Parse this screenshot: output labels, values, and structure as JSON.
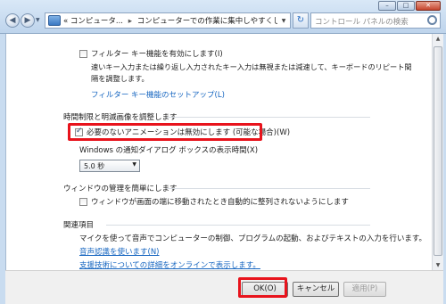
{
  "window": {
    "minimize": "–",
    "maximize": "□",
    "close": "✕"
  },
  "nav": {
    "back": "◀",
    "forward": "▶",
    "dropdown": "▼"
  },
  "address": {
    "chevrons": "«",
    "crumb1": "コンピュータ...",
    "crumb2": "コンピューターでの作業に集中しやすくします",
    "arrow": "▼"
  },
  "refresh_glyph": "↻",
  "search": {
    "placeholder": "コントロール パネルの検索"
  },
  "filter_keys": {
    "checkbox_label": "フィルター キー機能を有効にします(I)",
    "checked": false,
    "description_line1": "速いキー入力または繰り返し入力されたキー入力は無視または減速して、キーボードのリピート間",
    "description_line2": "隔を調整します。",
    "setup_link": "フィルター キー機能のセットアップ(L)"
  },
  "time_limits": {
    "heading": "時間制限と明滅画像を調整します",
    "animation_checkbox": "必要のないアニメーションは無効にします (可能な場合)(W)",
    "animation_checked": true,
    "notify_label": "Windows の通知ダイアログ ボックスの表示時間(X)",
    "notify_value": "5.0 秒"
  },
  "window_management": {
    "heading": "ウィンドウの管理を簡単にします",
    "checkbox_label": "ウィンドウが画面の端に移動されたとき自動的に整列されないようにします",
    "checked": false
  },
  "related": {
    "heading": "関連項目",
    "text": "マイクを使って音声でコンピューターの制御、プログラムの起動、およびテキストの入力を行います。",
    "link1": "音声認識を使います(N)",
    "link2": "支援技術についての詳細をオンラインで表示します。"
  },
  "buttons": {
    "ok": "OK(O)",
    "cancel": "キャンセル",
    "apply": "適用(P)"
  },
  "colors": {
    "highlight": "#e8131c",
    "link": "#1565c0"
  }
}
